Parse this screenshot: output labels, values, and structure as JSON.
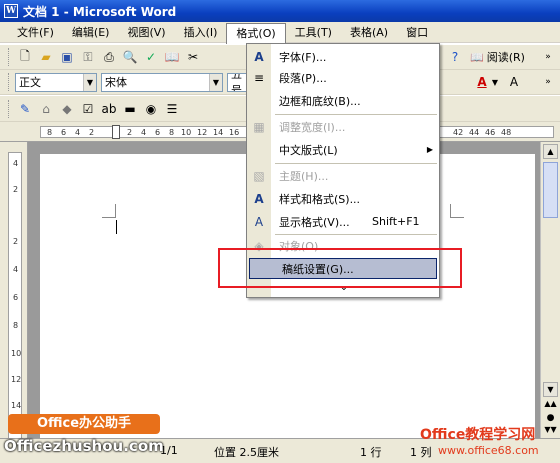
{
  "window": {
    "title": "文档 1 - Microsoft Word",
    "icon": "W"
  },
  "menubar": {
    "items": [
      "文件(F)",
      "编辑(E)",
      "视图(V)",
      "插入(I)",
      "格式(O)",
      "工具(T)",
      "表格(A)",
      "窗口"
    ]
  },
  "toolbar": {
    "read_label": "阅读(R)"
  },
  "format_toolbar": {
    "style": "正文",
    "font": "宋体",
    "size": "五号"
  },
  "format_menu": {
    "items": [
      {
        "label": "字体(F)...",
        "icon": "A",
        "disabled": false
      },
      {
        "label": "段落(P)...",
        "icon": "≡",
        "disabled": false
      },
      {
        "label": "边框和底纹(B)...",
        "icon": "",
        "disabled": false
      },
      {
        "label": "调整宽度(I)...",
        "icon": "▦",
        "disabled": true
      },
      {
        "label": "中文版式(L)",
        "icon": "",
        "disabled": false,
        "arrow": "▶"
      },
      {
        "label": "主题(H)...",
        "icon": "▧",
        "disabled": true
      },
      {
        "label": "样式和格式(S)...",
        "icon": "A",
        "disabled": false
      },
      {
        "label": "显示格式(V)...",
        "icon": "A",
        "disabled": false,
        "shortcut": "Shift+F1"
      },
      {
        "label": "对象(O)...",
        "icon": "◈",
        "disabled": true
      },
      {
        "label": "稿纸设置(G)...",
        "icon": "",
        "disabled": false,
        "highlighted": true
      }
    ],
    "expand_glyph": "⌄"
  },
  "ruler": {
    "left_nums": [
      "8",
      "6",
      "4",
      "2",
      "2",
      "4",
      "6",
      "8",
      "10",
      "12",
      "14",
      "16"
    ],
    "right_nums": [
      "42",
      "44",
      "46",
      "48"
    ]
  },
  "vruler": {
    "nums": [
      "4",
      "2",
      "2",
      "4",
      "6",
      "8",
      "10",
      "12",
      "14"
    ]
  },
  "statusbar": {
    "page": "1/1",
    "position": "位置 2.5厘米",
    "line": "1 行",
    "col": "1 列"
  },
  "watermark": {
    "left_title": "Office办公助手",
    "left_url": "Officezhushou.com",
    "right_title": "Office教程学习网",
    "right_url": "www.office68.com"
  },
  "colors": {
    "title_bar": "#0a3fbf",
    "menu_highlight": "#b6bdd2",
    "annotation": "#e81c24"
  }
}
